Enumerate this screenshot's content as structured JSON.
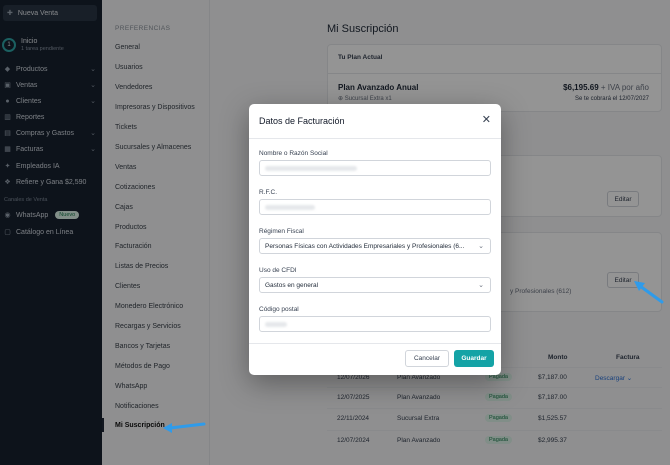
{
  "sidebar": {
    "new_sale": "Nueva Venta",
    "start_title": "Inicio",
    "start_subtitle": "1 tarea pendiente",
    "start_count": "1",
    "items": [
      {
        "label": "Productos",
        "icon": "tag-icon",
        "chevron": true
      },
      {
        "label": "Ventas",
        "icon": "cart-icon",
        "chevron": true
      },
      {
        "label": "Clientes",
        "icon": "users-icon",
        "chevron": true
      },
      {
        "label": "Reportes",
        "icon": "bar-chart-icon",
        "chevron": false
      },
      {
        "label": "Compras y Gastos",
        "icon": "wallet-icon",
        "chevron": true
      },
      {
        "label": "Facturas",
        "icon": "invoice-icon",
        "chevron": true
      },
      {
        "label": "Empleados IA",
        "icon": "sparkle-icon",
        "chevron": false
      },
      {
        "label": "Refiere y Gana $2,590",
        "icon": "gift-icon",
        "chevron": false
      }
    ],
    "section_label": "Canales de Venta",
    "whatsapp_label": "WhatsApp",
    "whatsapp_badge": "Nuevo",
    "catalog_label": "Catálogo en Línea"
  },
  "preferences": {
    "title": "PREFERENCIAS",
    "items": [
      "General",
      "Usuarios",
      "Vendedores",
      "Impresoras y Dispositivos",
      "Tickets",
      "Sucursales y Almacenes",
      "Ventas",
      "Cotizaciones",
      "Cajas",
      "Productos",
      "Facturación",
      "Listas de Precios",
      "Clientes",
      "Monedero Electrónico",
      "Recargas y Servicios",
      "Bancos y Tarjetas",
      "Métodos de Pago",
      "WhatsApp",
      "Notificaciones",
      "Mi Suscripción"
    ],
    "active": "Mi Suscripción"
  },
  "main": {
    "title": "Mi Suscripción",
    "current_plan_header": "Tu Plan Actual",
    "plan_name": "Plan Avanzado Anual",
    "plan_price": "$6,195.69",
    "plan_price_suffix": " + IVA por año",
    "addon": "Sucursal Extra x1",
    "charge_note": "Se te cobrará el 12/07/2027",
    "edit_label": "Editar",
    "regime_partial": "y Profesionales (612)",
    "table": {
      "headers": {
        "monto": "Monto",
        "factura": "Factura"
      },
      "rows": [
        {
          "date": "12/07/2026",
          "concept": "Plan Avanzado",
          "status": "Pagada",
          "amount": "$7,187.00",
          "invoice": "Descargar"
        },
        {
          "date": "12/07/2025",
          "concept": "Plan Avanzado",
          "status": "Pagada",
          "amount": "$7,187.00",
          "invoice": ""
        },
        {
          "date": "22/11/2024",
          "concept": "Sucursal Extra",
          "status": "Pagada",
          "amount": "$1,525.57",
          "invoice": ""
        },
        {
          "date": "12/07/2024",
          "concept": "Plan Avanzado",
          "status": "Pagada",
          "amount": "$2,995.37",
          "invoice": ""
        }
      ]
    }
  },
  "modal": {
    "title": "Datos de Facturación",
    "fields": {
      "name_label": "Nombre o Razón Social",
      "rfc_label": "R.F.C.",
      "regime_label": "Régimen Fiscal",
      "regime_value": "Personas Físicas con Actividades Empresariales y Profesionales (6...",
      "cfdi_label": "Uso de CFDI",
      "cfdi_value": "Gastos en general",
      "zip_label": "Código postal"
    },
    "cancel_label": "Cancelar",
    "save_label": "Guardar"
  },
  "colors": {
    "sidebar_bg": "#172230",
    "accent": "#14a3a6",
    "paid_badge_bg": "#dff5ea",
    "arrow": "#2f9bea"
  }
}
